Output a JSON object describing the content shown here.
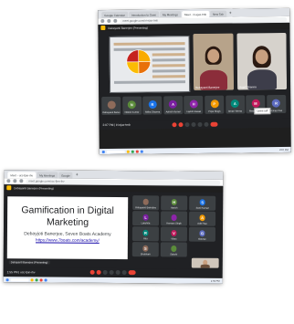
{
  "top": {
    "tabs": [
      "Google Calendar",
      "Introduction to Gami",
      "My Meetings",
      "Meet - iri-ejax-tmb",
      "New Tab"
    ],
    "url": "meet.google.com/iri-ejax-tmb",
    "infobar": "Debayanti Banerjee (Presenting)",
    "cam_left_name": "Debayanti Banerjee",
    "cam_right_name": "Anjali Sharma",
    "tiles": [
      "Debayanti Banerjee",
      "Nitesh Kumar",
      "Ritika Sharma",
      "Ashish Kumar",
      "Harish Rawat",
      "Priya Singh",
      "Aman Verma",
      "Meera Joshi",
      "Rohan Das"
    ],
    "tile_initials": [
      "",
      "N",
      "R",
      "A",
      "H",
      "P",
      "A",
      "M",
      "R"
    ],
    "tooltip": "Leave call",
    "time": "2:07 PM  |  iri-ejax-tmb",
    "clock": "2:07 PM"
  },
  "bottom": {
    "tabs": [
      "Meet - ucc-fjnn-ihv",
      "My Meetings",
      "Google"
    ],
    "url": "meet.google.com/ucc-fjnn-ihv",
    "infobar": "Debayanti Banerjee (Presenting)",
    "slide_title_1": "Gamification in Digital",
    "slide_title_2": "Marketing",
    "slide_author": "Debayjoti Banerjee, Seven Boats Academy",
    "slide_link": "https://www.7boats.com/academy/",
    "presenting_label": "Debayanti Banerjee (Presenting)",
    "tiles": [
      "Debayanti Banerjee",
      "Harish",
      "Sunil Kumar",
      "Lakshita",
      "Hemant Singh",
      "Aditi Rao",
      "Ritu",
      "Vikas",
      "Gaurav",
      "Shubham",
      "Sakshi",
      "You"
    ],
    "tile_initials": [
      "",
      "H",
      "S",
      "L",
      "",
      "A",
      "R",
      "V",
      "G",
      "S",
      "",
      ""
    ],
    "time": "1:55 PM  |  ucc-fjnn-ihv",
    "clock": "1:55 PM"
  },
  "colors": {
    "avatar": [
      "#8e6b5a",
      "#5b8c3a",
      "#1a73e8",
      "#7b1fa2",
      "#8e24aa",
      "#f29900",
      "#00897b",
      "#c2185b",
      "#5c6bc0"
    ],
    "pie": [
      "#f9ab00",
      "#e8710a",
      "#fbbc04",
      "#c5221f"
    ]
  }
}
